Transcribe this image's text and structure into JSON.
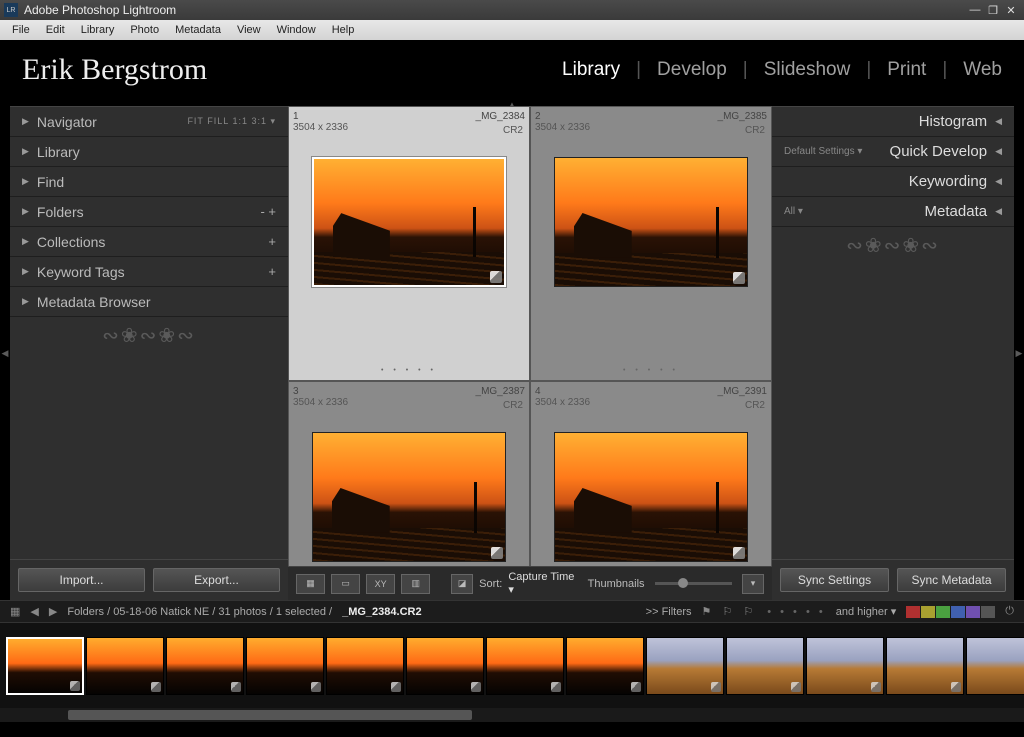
{
  "app": {
    "title": "Adobe Photoshop Lightroom",
    "logo": "LR"
  },
  "menus": [
    "File",
    "Edit",
    "Library",
    "Photo",
    "Metadata",
    "View",
    "Window",
    "Help"
  ],
  "identity": {
    "name": "Erik Bergstrom"
  },
  "modules": {
    "items": [
      "Library",
      "Develop",
      "Slideshow",
      "Print",
      "Web"
    ],
    "active": "Library"
  },
  "left_panel": {
    "navigator": {
      "label": "Navigator",
      "opts": "FIT   FILL   1:1   3:1 ▾"
    },
    "sections": [
      {
        "label": "Library",
        "extra": ""
      },
      {
        "label": "Find",
        "extra": ""
      },
      {
        "label": "Folders",
        "extra": "-  +"
      },
      {
        "label": "Collections",
        "extra": "+"
      },
      {
        "label": "Keyword Tags",
        "extra": "+"
      },
      {
        "label": "Metadata Browser",
        "extra": ""
      }
    ],
    "import": "Import...",
    "export": "Export..."
  },
  "right_panel": {
    "histogram": "Histogram",
    "quick_develop": {
      "mini": "Default Settings ▾",
      "label": "Quick Develop"
    },
    "keywording": "Keywording",
    "metadata": {
      "mini": "All ▾",
      "label": "Metadata"
    },
    "sync_settings": "Sync Settings",
    "sync_metadata": "Sync Metadata"
  },
  "grid": [
    {
      "index": "1",
      "name": "_MG_2384",
      "dims": "3504 x 2336",
      "ext": "CR2",
      "selected": true
    },
    {
      "index": "2",
      "name": "_MG_2385",
      "dims": "3504 x 2336",
      "ext": "CR2",
      "selected": false
    },
    {
      "index": "3",
      "name": "_MG_2387",
      "dims": "3504 x 2336",
      "ext": "CR2",
      "selected": false
    },
    {
      "index": "4",
      "name": "_MG_2391",
      "dims": "3504 x 2336",
      "ext": "CR2",
      "selected": false
    }
  ],
  "toolbar": {
    "sort_label": "Sort:",
    "sort_value": "Capture Time ▾",
    "thumbs_label": "Thumbnails"
  },
  "pathbar": {
    "breadcrumb": "Folders / 05-18-06 Natick NE / 31 photos / 1 selected /",
    "filename": "_MG_2384.CR2",
    "filters": ">>  Filters",
    "and_higher": "and higher ▾",
    "swatches": [
      "#b03030",
      "#a8a030",
      "#4aa040",
      "#4060b0",
      "#7050b0",
      "#555555"
    ]
  },
  "filmstrip": {
    "count": 13,
    "selected": 0,
    "day_from": 8
  }
}
